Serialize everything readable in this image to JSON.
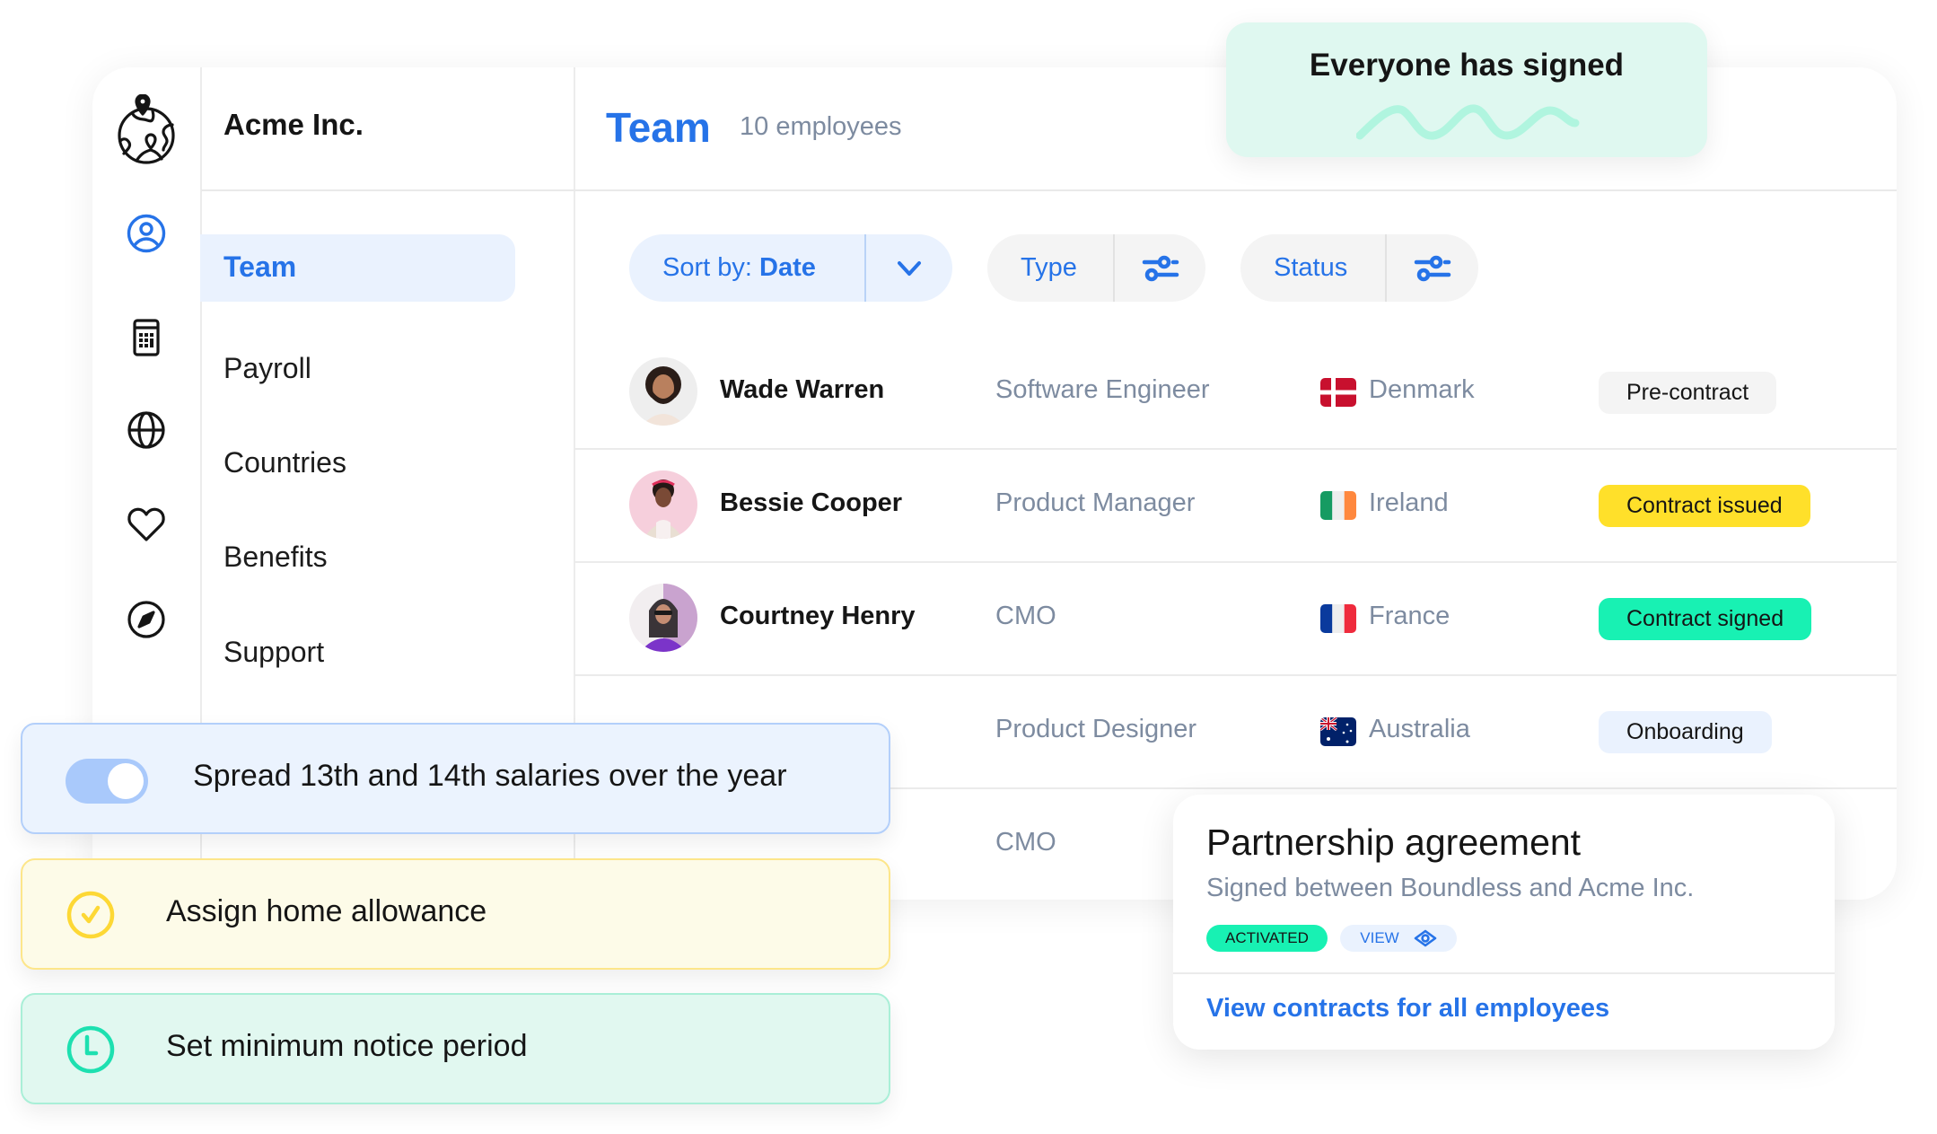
{
  "company": {
    "name": "Acme Inc."
  },
  "nav": {
    "items": [
      {
        "label": "Team",
        "icon": "user-circle-icon",
        "active": true
      },
      {
        "label": "Payroll",
        "icon": "calculator-icon",
        "active": false
      },
      {
        "label": "Countries",
        "icon": "globe-icon",
        "active": false
      },
      {
        "label": "Benefits",
        "icon": "heart-icon",
        "active": false
      },
      {
        "label": "Support",
        "icon": "compass-icon",
        "active": false
      }
    ]
  },
  "header": {
    "title": "Team",
    "count": "10 employees"
  },
  "filters": {
    "sort_prefix": "Sort by:",
    "sort_value": "Date",
    "type_label": "Type",
    "status_label": "Status"
  },
  "employees": [
    {
      "name": "Wade Warren",
      "title": "Software Engineer",
      "country": "Denmark",
      "status": "Pre-contract",
      "status_color": "#f4f4f4"
    },
    {
      "name": "Bessie Cooper",
      "title": "Product Manager",
      "country": "Ireland",
      "status": "Contract issued",
      "status_color": "#ffe02a"
    },
    {
      "name": "Courtney Henry",
      "title": "CMO",
      "country": "France",
      "status": "Contract signed",
      "status_color": "#18f1b3"
    },
    {
      "name": "",
      "title": "Product Designer",
      "country": "Australia",
      "status": "Onboarding",
      "status_color": "#eaf2fe"
    },
    {
      "name": "",
      "title": "CMO",
      "country": "",
      "status": "",
      "status_color": ""
    }
  ],
  "signed_card": {
    "title": "Everyone has signed"
  },
  "options": [
    {
      "label": "Spread 13th and 14th salaries over the year",
      "icon": "toggle-icon",
      "toggle_on": true
    },
    {
      "label": "Assign home allowance",
      "icon": "check-circle-icon"
    },
    {
      "label": "Set minimum notice period",
      "icon": "clock-icon"
    }
  ],
  "contract_card": {
    "title": "Partnership agreement",
    "subtitle": "Signed between Boundless and Acme Inc.",
    "status_tag": "ACTIVATED",
    "view_label": "VIEW",
    "link": "View contracts for all employees"
  },
  "colors": {
    "accent": "#2673e8",
    "muted_text": "#7d8ba0",
    "mint": "#18f1b3",
    "yellow": "#ffe02a"
  }
}
